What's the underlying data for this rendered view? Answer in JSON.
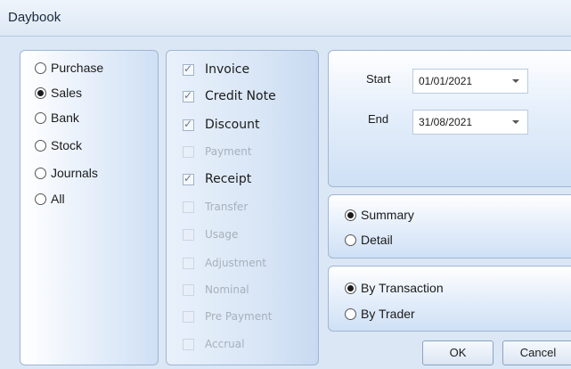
{
  "window": {
    "title": "Daybook"
  },
  "report_type": {
    "options": [
      {
        "label": "Purchase",
        "selected": false
      },
      {
        "label": "Sales",
        "selected": true
      },
      {
        "label": "Bank",
        "selected": false
      },
      {
        "label": "Stock",
        "selected": false
      },
      {
        "label": "Journals",
        "selected": false
      },
      {
        "label": "All",
        "selected": false
      }
    ]
  },
  "transaction_types": {
    "items": [
      {
        "label": "Invoice",
        "checked": true,
        "enabled": true
      },
      {
        "label": "Credit Note",
        "checked": true,
        "enabled": true
      },
      {
        "label": "Discount",
        "checked": true,
        "enabled": true
      },
      {
        "label": "Payment",
        "checked": false,
        "enabled": false
      },
      {
        "label": "Receipt",
        "checked": true,
        "enabled": true
      },
      {
        "label": "Transfer",
        "checked": false,
        "enabled": false
      },
      {
        "label": "Usage",
        "checked": false,
        "enabled": false
      },
      {
        "label": "Adjustment",
        "checked": false,
        "enabled": false
      },
      {
        "label": "Nominal",
        "checked": false,
        "enabled": false
      },
      {
        "label": "Pre Payment",
        "checked": false,
        "enabled": false
      },
      {
        "label": "Accrual",
        "checked": false,
        "enabled": false
      }
    ]
  },
  "date_range": {
    "start_label": "Start",
    "start_value": "01/01/2021",
    "end_label": "End",
    "end_value": "31/08/2021"
  },
  "detail_level": {
    "options": [
      {
        "label": "Summary",
        "selected": true
      },
      {
        "label": "Detail",
        "selected": false
      }
    ]
  },
  "grouping": {
    "options": [
      {
        "label": "By Transaction",
        "selected": true
      },
      {
        "label": "By Trader",
        "selected": false
      }
    ]
  },
  "buttons": {
    "ok_label": "OK",
    "cancel_label": "Cancel"
  }
}
